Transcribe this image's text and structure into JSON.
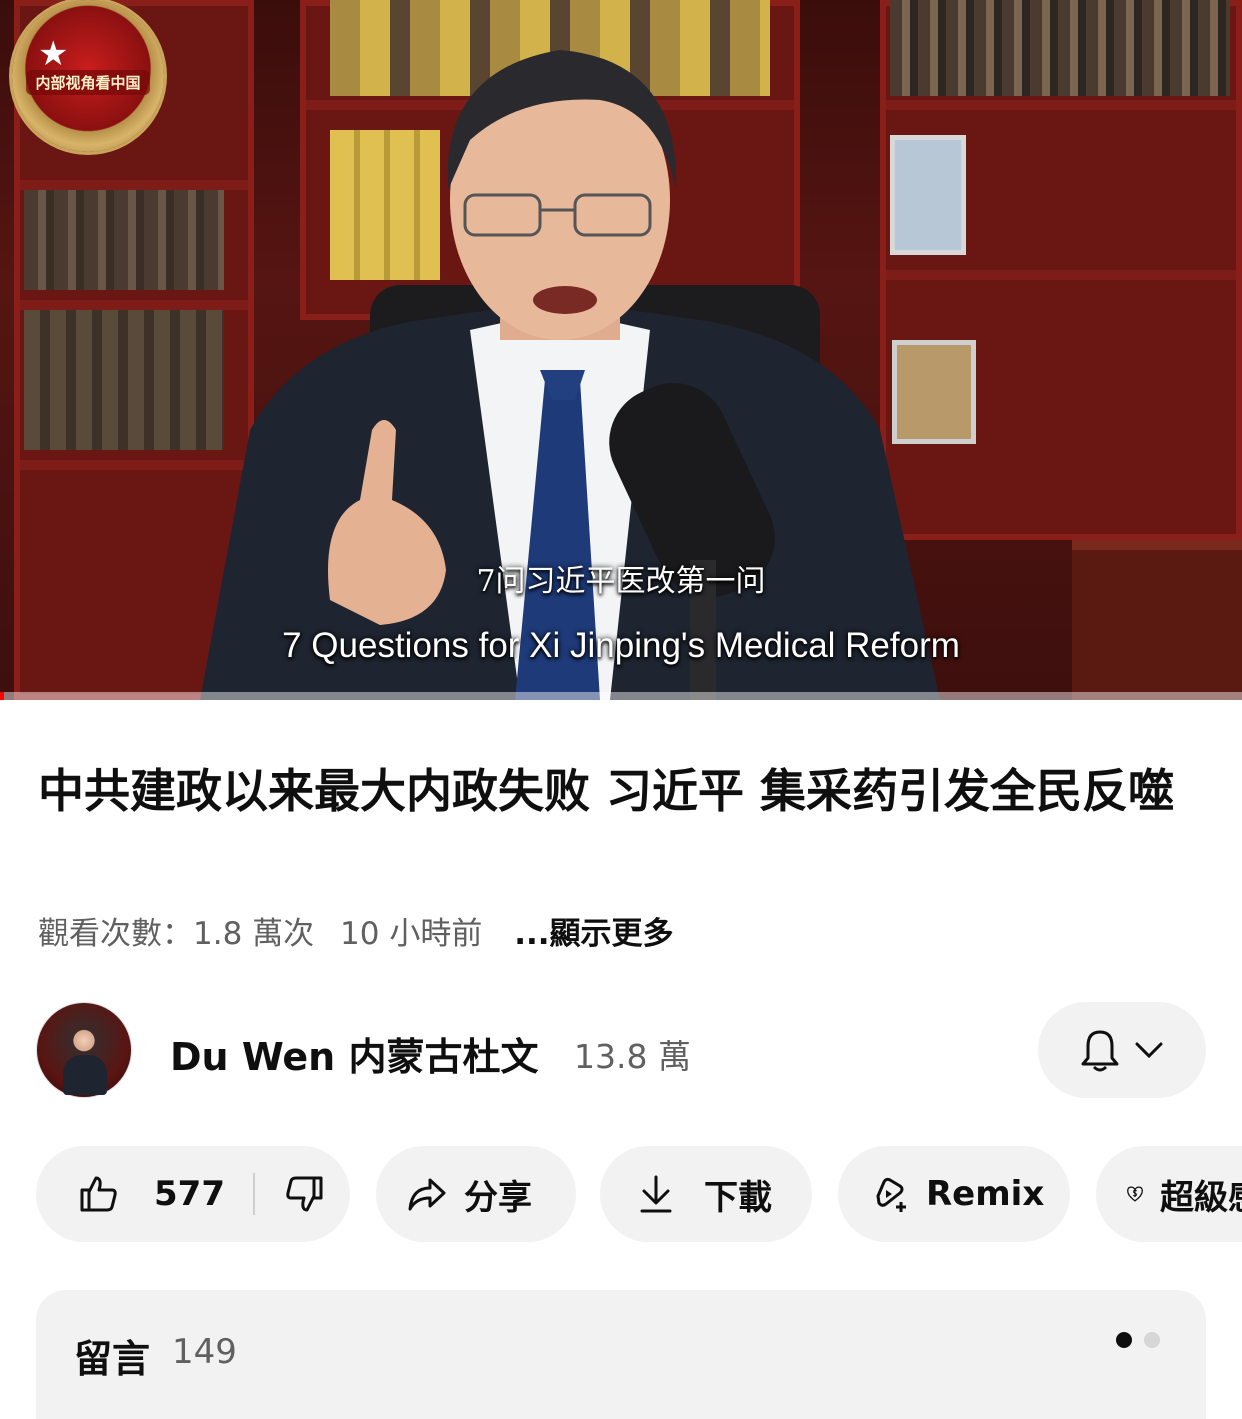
{
  "video": {
    "logo_text": "内部视角看中国",
    "subtitle_cn": "7问习近平医改第一问",
    "subtitle_en": "7 Questions for Xi Jinping's Medical Reform",
    "progress_fraction": 0.003
  },
  "title": "中共建政以来最大内政失败 习近平 集采药引发全民反噬",
  "meta": {
    "views": "觀看次數：1.8 萬次",
    "age": "10 小時前",
    "more": "...顯示更多"
  },
  "channel": {
    "name": "Du Wen 内蒙古杜文",
    "subscribers": "13.8 萬",
    "notification_icon": "bell-icon"
  },
  "actions": {
    "likes": "577",
    "share": "分享",
    "download": "下載",
    "remix": "Remix",
    "thanks": "超級感謝"
  },
  "comments": {
    "title": "留言",
    "count": "149",
    "page_indicator": {
      "total": 2,
      "active": 0
    }
  },
  "colors": {
    "accent_red": "#ff0000",
    "pill_bg": "#f2f2f2",
    "secondary_text": "#606060",
    "primary_text": "#0f0f0f"
  }
}
